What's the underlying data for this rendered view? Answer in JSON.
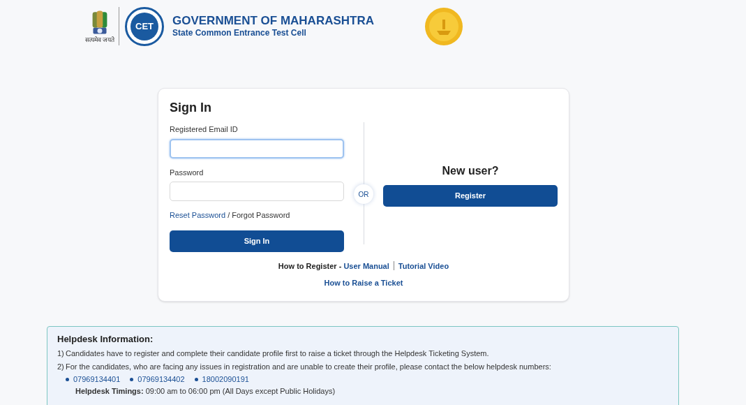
{
  "header": {
    "title": "GOVERNMENT OF MAHARASHTRA",
    "subtitle": "State Common Entrance Test Cell",
    "cet_logo": "CET",
    "emblem_caption": "सत्यमेव जयते"
  },
  "sign_in": {
    "heading": "Sign In",
    "fields": [
      {
        "label": "Registered Email ID",
        "focused": true
      },
      {
        "label": "Password",
        "focused": false
      }
    ],
    "reset_link": "Reset Password",
    "separator": " / ",
    "forgot_text": "Forgot Password",
    "button": "Sign In"
  },
  "divider_label": "OR",
  "new_user": {
    "heading": "New user?",
    "button": "Register"
  },
  "how_to": {
    "label": "How to Register - ",
    "links": [
      "User Manual",
      "Tutorial Video"
    ],
    "ticket_link": "How to Raise a Ticket"
  },
  "helpdesk": {
    "heading": "Helpdesk Information:",
    "items": [
      {
        "marker": "1)",
        "text": "Candidates have to register and complete their candidate profile first to raise a ticket through the Helpdesk Ticketing System."
      },
      {
        "marker": "2)",
        "text": "For the candidates, who are facing any issues in registration and are unable to create their profile, please contact the below helpdesk numbers:"
      }
    ],
    "numbers": [
      "07969134401",
      "07969134402",
      "18002090191"
    ],
    "timings_label": "Helpdesk Timings:",
    "timings": " 09:00 am to 06:00 pm (All Days except Public Holidays)"
  }
}
